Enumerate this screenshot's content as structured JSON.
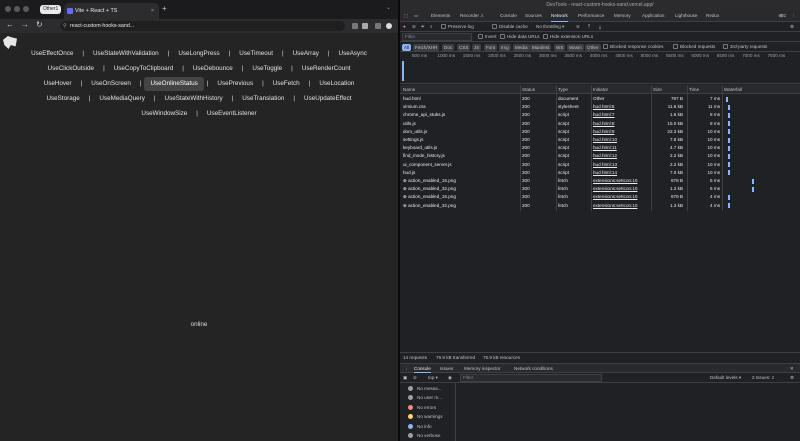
{
  "browser": {
    "group_label": "Other1",
    "tab_title": "Vite + React + TS",
    "tab_close": "×",
    "new_tab": "+",
    "tab_menu": "⌄",
    "address": "react-custom-hooks-sand...",
    "nav": {
      "back": "←",
      "forward": "→",
      "reload": "↻"
    }
  },
  "app": {
    "rows": [
      [
        "UseEffectOnce",
        "UseStateWithValidation",
        "UseLongPress",
        "UseTimeout",
        "UseArray",
        "UseAsync"
      ],
      [
        "UseClickOutside",
        "UseCopyToClipboard",
        "UseDebounce",
        "UseToggle",
        "UseRenderCount"
      ],
      [
        "UseHover",
        "UseOnScreen",
        "UseOnlineStatus",
        "UsePrevious",
        "UseFetch",
        "UseLocation"
      ],
      [
        "UseStorage",
        "UseMediaQuery",
        "UseStateWithHistory",
        "UseTranslation",
        "UseUpdateEffect"
      ],
      [
        "UseWindowSize",
        "UseEventListener"
      ]
    ],
    "separator": "|",
    "active_hook": "UseOnlineStatus",
    "status_text": "online"
  },
  "devtools": {
    "title": "DevTools - react-custom-hooks-sand.vercel.app/",
    "tabs": [
      "Elements",
      "Recorder ⚠",
      "Console",
      "Sources",
      "Network",
      "Performance",
      "Memory",
      "Application",
      "Lighthouse",
      "Redux"
    ],
    "active_tab": "Network",
    "error_count": "2",
    "toolbar": {
      "preserve_log": "Preserve log",
      "disable_cache": "Disable cache",
      "throttling": "No throttling"
    },
    "filter": {
      "placeholder": "Filter",
      "invert": "Invert",
      "hide_data_urls": "Hide data URLs",
      "hide_ext_urls": "Hide extension URLs"
    },
    "type_chips": [
      "All",
      "Fetch/XHR",
      "Doc",
      "CSS",
      "JS",
      "Font",
      "Img",
      "Media",
      "Manifest",
      "WS",
      "Wasm",
      "Other"
    ],
    "blocked": {
      "cookies": "Blocked response cookies",
      "requests": "Blocked requests",
      "third_party": "3rd-party requests"
    },
    "timeline_ticks": [
      "500 ms",
      "1000 ms",
      "1500 ms",
      "2000 ms",
      "2500 ms",
      "3000 ms",
      "3500 ms",
      "4000 ms",
      "4500 ms",
      "5000 ms",
      "5500 ms",
      "6000 ms",
      "6500 ms",
      "7000 ms",
      "7500 ms"
    ],
    "columns": [
      "Name",
      "Status",
      "Type",
      "Initiator",
      "Size",
      "Time",
      "Waterfall"
    ],
    "requests": [
      {
        "name": "hud.html",
        "status": "200",
        "type": "document",
        "initiator": "Other",
        "size": "797 B",
        "time": "7 ms",
        "wf": 2
      },
      {
        "name": "vimium.css",
        "status": "200",
        "type": "stylesheet",
        "initiator": "hud.html:6",
        "size": "11.6 kB",
        "time": "11 ms",
        "wf": 4
      },
      {
        "name": "chrome_api_stubs.js",
        "status": "200",
        "type": "script",
        "initiator": "hud.html:7",
        "size": "1.6 kB",
        "time": "8 ms",
        "wf": 4
      },
      {
        "name": "utils.js",
        "status": "200",
        "type": "script",
        "initiator": "hud.html:8",
        "size": "15.0 kB",
        "time": "8 ms",
        "wf": 4
      },
      {
        "name": "dom_utils.js",
        "status": "200",
        "type": "script",
        "initiator": "hud.html:9",
        "size": "22.3 kB",
        "time": "10 ms",
        "wf": 4
      },
      {
        "name": "settings.js",
        "status": "200",
        "type": "script",
        "initiator": "hud.html:10",
        "size": "7.8 kB",
        "time": "10 ms",
        "wf": 4
      },
      {
        "name": "keyboard_utils.js",
        "status": "200",
        "type": "script",
        "initiator": "hud.html:11",
        "size": "4.7 kB",
        "time": "10 ms",
        "wf": 4
      },
      {
        "name": "find_mode_history.js",
        "status": "200",
        "type": "script",
        "initiator": "hud.html:12",
        "size": "2.2 kB",
        "time": "10 ms",
        "wf": 4
      },
      {
        "name": "ui_component_server.js",
        "status": "200",
        "type": "script",
        "initiator": "hud.html:13",
        "size": "2.2 kB",
        "time": "10 ms",
        "wf": 4
      },
      {
        "name": "hud.js",
        "status": "200",
        "type": "script",
        "initiator": "hud.html:14",
        "size": "7.0 kB",
        "time": "10 ms",
        "wf": 4
      },
      {
        "name": "action_enabled_16.png",
        "status": "200",
        "type": "fetch",
        "initiator": "extensions:setIcon:10",
        "size": "678 B",
        "time": "5 ms",
        "wf": 28
      },
      {
        "name": "action_enabled_32.png",
        "status": "200",
        "type": "fetch",
        "initiator": "extensions:setIcon:10",
        "size": "1.3 kB",
        "time": "6 ms",
        "wf": 28
      },
      {
        "name": "action_enabled_16.png",
        "status": "200",
        "type": "fetch",
        "initiator": "extensions:setIcon:10",
        "size": "679 B",
        "time": "4 ms",
        "wf": 4
      },
      {
        "name": "action_enabled_32.png",
        "status": "200",
        "type": "fetch",
        "initiator": "extensions:setIcon:10",
        "size": "1.3 kB",
        "time": "4 ms",
        "wf": 4
      }
    ],
    "summary": {
      "requests": "14 requests",
      "transferred": "79.9 kB transferred",
      "resources": "75.9 kB resources"
    },
    "drawer": {
      "tabs": [
        "Console",
        "Issues",
        "Memory inspector",
        "Network conditions"
      ],
      "context": "top",
      "filter_placeholder": "Filter",
      "levels": "Default levels",
      "issues": "2 Issues:",
      "issue_count": "2",
      "sidebar": [
        "No messa...",
        "No user m...",
        "No errors",
        "No warnings",
        "No info",
        "No verbose"
      ]
    }
  }
}
